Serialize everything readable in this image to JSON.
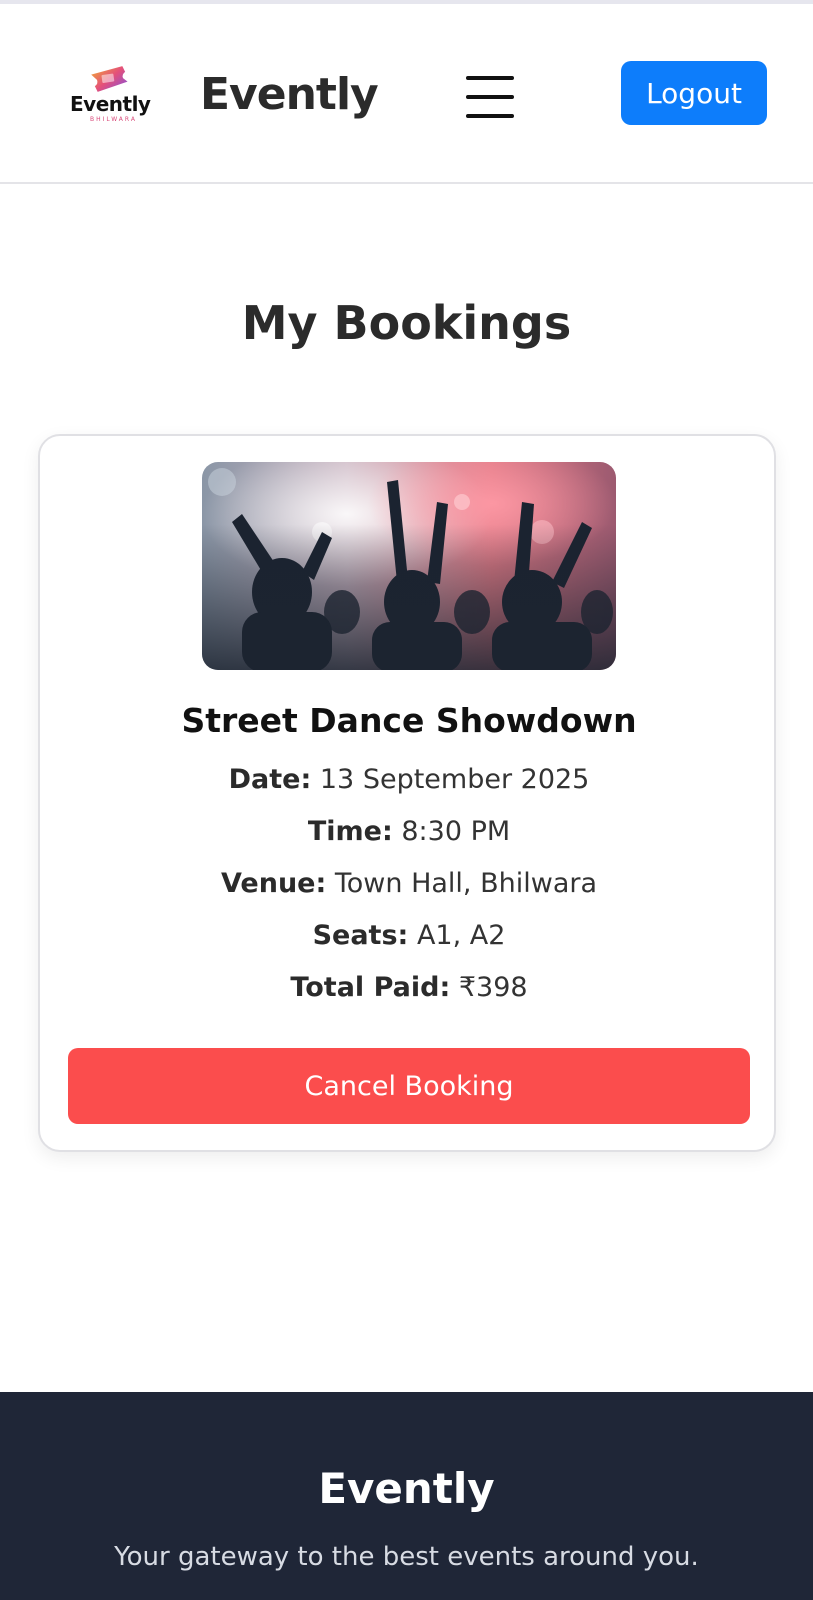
{
  "header": {
    "logo_text": "Evently",
    "logo_subtext": "BHILWARA",
    "brand": "Evently",
    "menu_icon": "hamburger-menu-icon",
    "logout_label": "Logout",
    "accent_color": "#0d7dfb"
  },
  "page": {
    "title": "My Bookings"
  },
  "booking": {
    "image_icon": "event-photo",
    "title": "Street Dance Showdown",
    "date_label": "Date:",
    "date": "13 September 2025",
    "time_label": "Time:",
    "time": "8:30 PM",
    "venue_label": "Venue:",
    "venue": "Town Hall, Bhilwara",
    "seats_label": "Seats:",
    "seats": "A1, A2",
    "total_label": "Total Paid:",
    "total": "₹398",
    "cancel_label": "Cancel Booking",
    "cancel_color": "#fb4d4d"
  },
  "footer": {
    "brand": "Evently",
    "tagline": "Your gateway to the best events around you.",
    "background_color": "#1f2637"
  }
}
